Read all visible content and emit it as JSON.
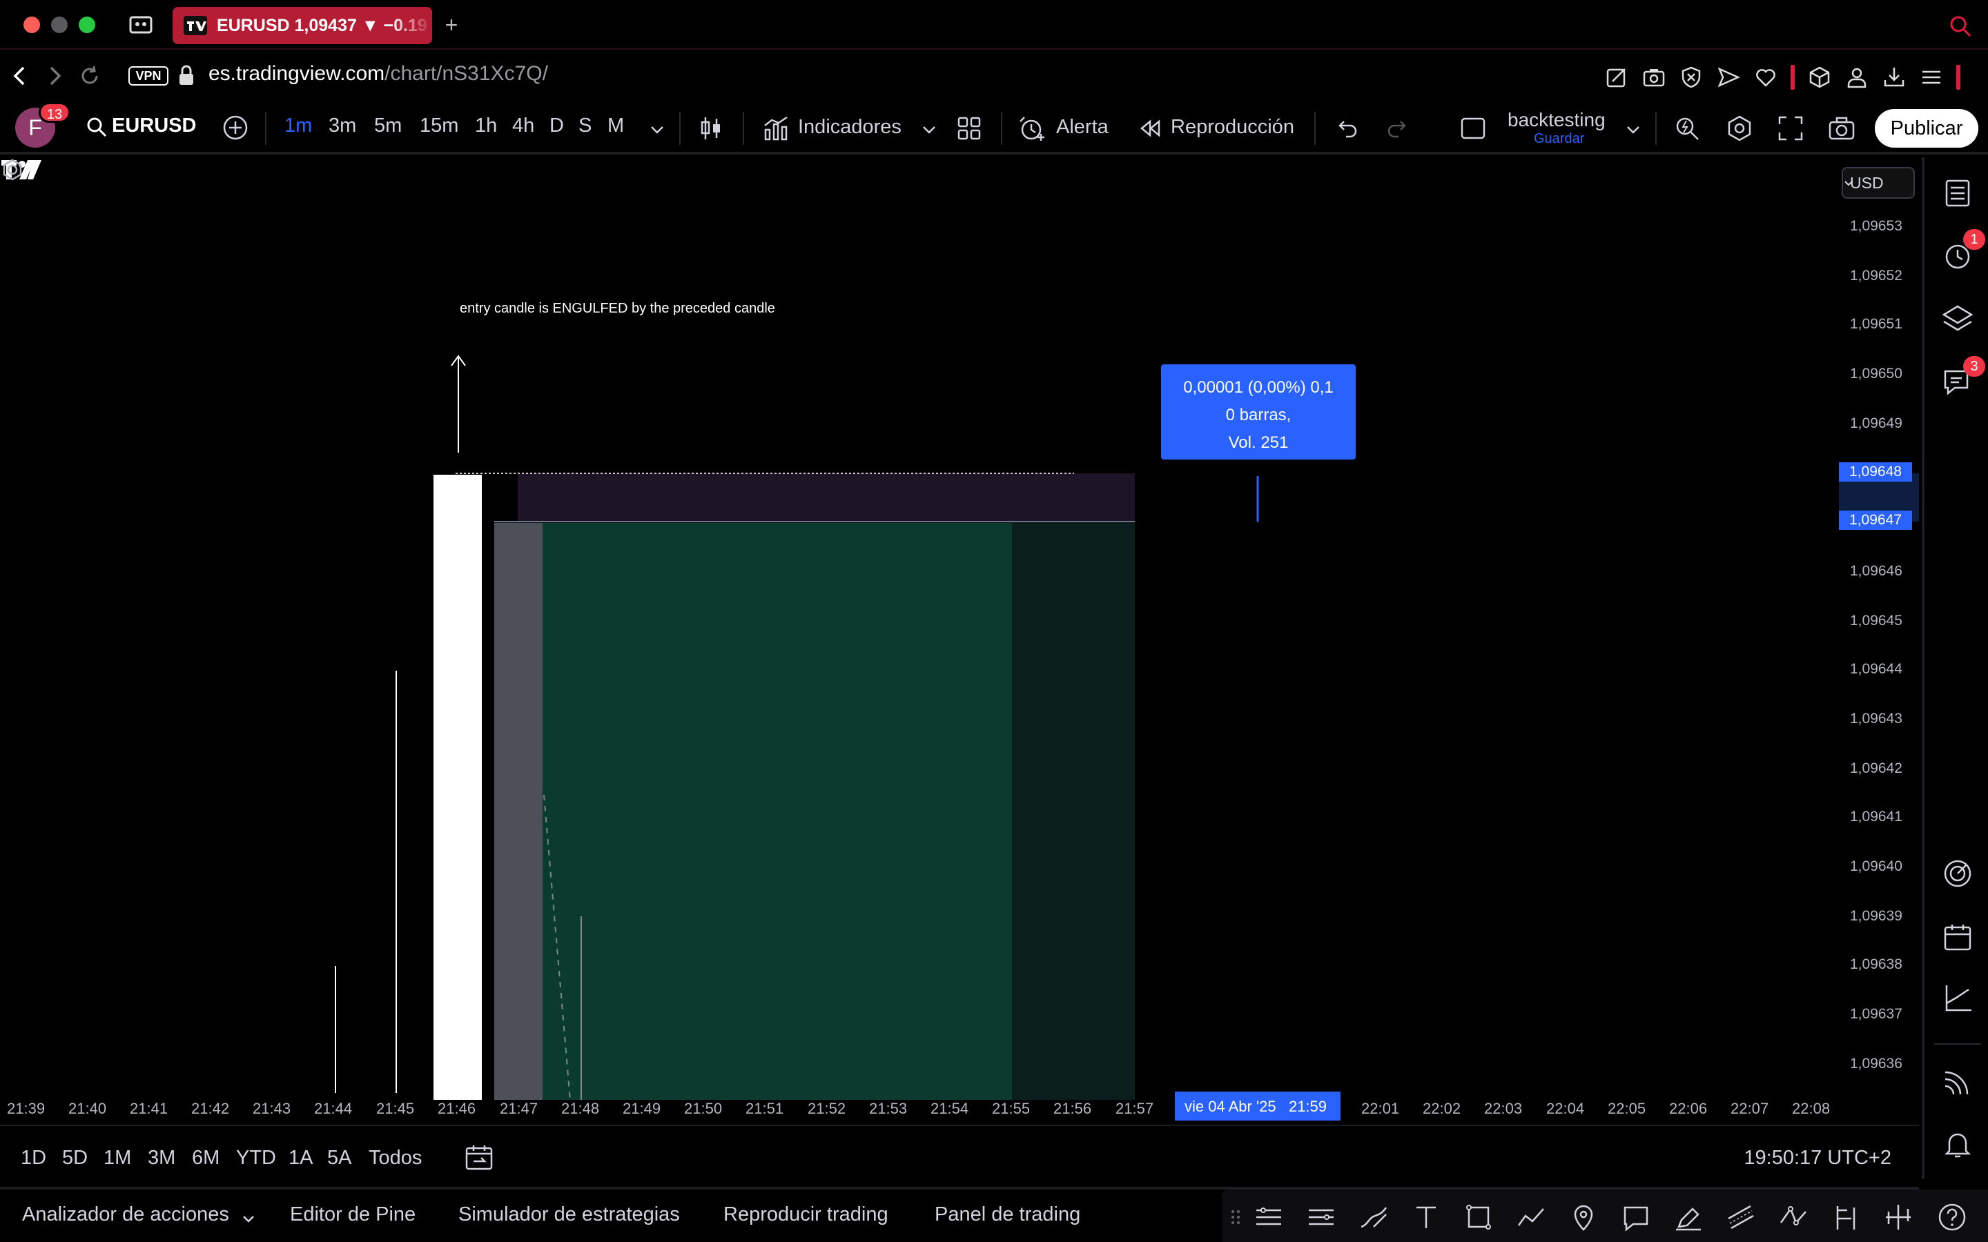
{
  "browser": {
    "tab_title": "EURUSD 1,09437 ▼ −0.19",
    "new_tab": "+",
    "vpn": "VPN",
    "url_host": "es.tradingview.com",
    "url_path": "/chart/nS31Xc7Q/",
    "colors": {
      "tab": "#b51d34",
      "close": "#ff5f57",
      "zoom": "#28c840"
    }
  },
  "toolbar": {
    "avatar_letter": "F",
    "notifications": "13",
    "symbol": "EURUSD",
    "intervals": [
      "1m",
      "3m",
      "5m",
      "15m",
      "1h",
      "4h",
      "D",
      "S",
      "M"
    ],
    "active_interval": "1m",
    "indicators": "Indicadores",
    "alert": "Alerta",
    "replay": "Reproducción",
    "layout_name": "backtesting",
    "layout_save": "Guardar",
    "publish": "Publicar"
  },
  "chart": {
    "currency": "USD",
    "annotation": "entry candle is ENGULFED by the preceded candle",
    "tooltip": {
      "line1": "0,00001 (0,00%) 0,1",
      "line2": "0 barras,",
      "line3": "Vol. 251"
    },
    "price_labels": [
      "1,09653",
      "1,09652",
      "1,09651",
      "1,09650",
      "1,09649",
      "1,09646",
      "1,09645",
      "1,09644",
      "1,09643",
      "1,09642",
      "1,09641",
      "1,09640",
      "1,09639",
      "1,09638",
      "1,09637",
      "1,09636"
    ],
    "price_highlight_upper": "1,09648",
    "price_highlight_lower": "1,09647",
    "time_labels": [
      "21:39",
      "21:40",
      "21:41",
      "21:42",
      "21:43",
      "21:44",
      "21:45",
      "21:46",
      "21:47",
      "21:48",
      "21:49",
      "21:50",
      "21:51",
      "21:52",
      "21:53",
      "21:54",
      "21:55",
      "21:56",
      "21:57",
      "22:01",
      "22:02",
      "22:03",
      "22:04",
      "22:05",
      "22:06",
      "22:07",
      "22:08"
    ],
    "time_highlight": "vie 04 Abr '25   21:59",
    "colors": {
      "profit_zone": "#0a3b2e",
      "risk_zone": "#1d1428",
      "accent": "#2962ff"
    }
  },
  "sidebar": {
    "alerts_badge": "1",
    "chat_badge": "3"
  },
  "rangebar": {
    "ranges": [
      "1D",
      "5D",
      "1M",
      "3M",
      "6M",
      "YTD",
      "1A",
      "5A",
      "Todos"
    ],
    "clock": "19:50:17 UTC+2"
  },
  "bottom": {
    "tabs": [
      "Analizador de acciones",
      "Editor de Pine",
      "Simulador de estrategias",
      "Reproducir trading",
      "Panel de trading"
    ]
  }
}
